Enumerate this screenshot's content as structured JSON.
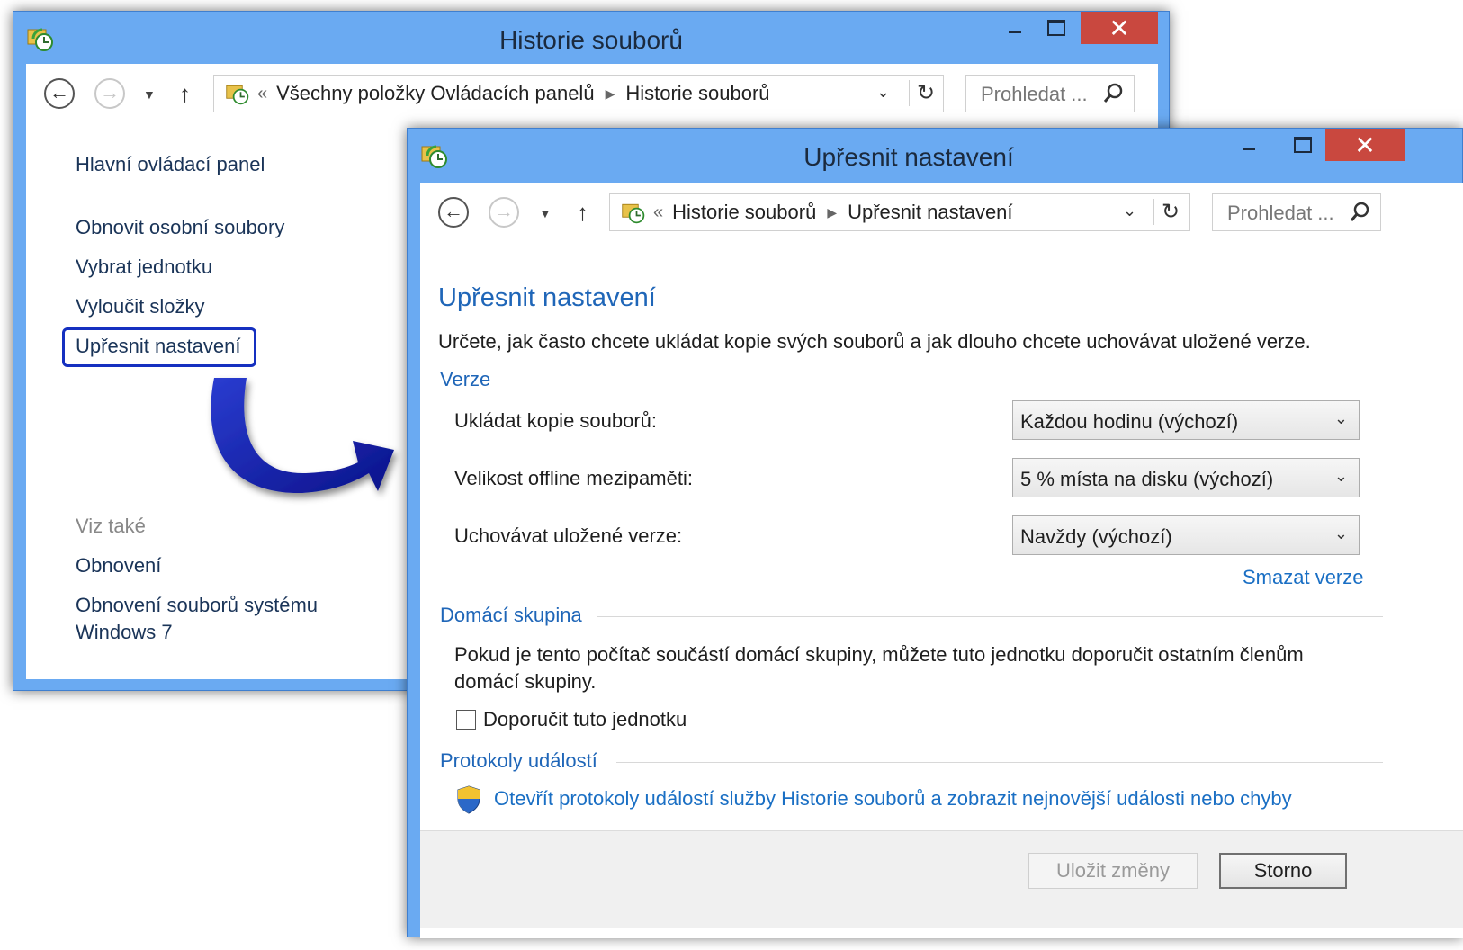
{
  "back_window": {
    "title": "Historie souborů",
    "address": {
      "overflow": "«",
      "crumb1": "Všechny položky Ovládacích panelů",
      "crumb2": "Historie souborů"
    },
    "search_placeholder": "Prohledat ...",
    "home_link": "Hlavní ovládací panel",
    "links": [
      "Obnovit osobní soubory",
      "Vybrat jednotku",
      "Vyloučit složky",
      "Upřesnit nastavení"
    ],
    "see_also": "Viz také",
    "see_also_links": [
      "Obnovení",
      "Obnovení souborů systému",
      "Windows 7"
    ]
  },
  "front_window": {
    "title": "Upřesnit nastavení",
    "address": {
      "overflow": "«",
      "crumb1": "Historie souborů",
      "crumb2": "Upřesnit nastavení"
    },
    "search_placeholder": "Prohledat ...",
    "heading": "Upřesnit nastavení",
    "intro": "Určete, jak často chcete ukládat kopie svých souborů a jak dlouho chcete uchovávat uložené verze.",
    "versions": {
      "label": "Verze",
      "save_copies_label": "Ukládat kopie souborů:",
      "save_copies_value": "Každou hodinu (výchozí)",
      "offline_cache_label": "Velikost offline mezipaměti:",
      "offline_cache_value": "5 % místa na disku (výchozí)",
      "keep_versions_label": "Uchovávat uložené verze:",
      "keep_versions_value": "Navždy (výchozí)",
      "delete_versions_link": "Smazat verze"
    },
    "homegroup": {
      "label": "Domácí skupina",
      "text_line1": "Pokud je tento počítač součástí domácí skupiny, můžete tuto jednotku doporučit ostatním členům",
      "text_line2": "domácí skupiny.",
      "checkbox_label": "Doporučit tuto jednotku",
      "checkbox_checked": false
    },
    "event_logs": {
      "label": "Protokoly událostí",
      "link": "Otevřít protokoly událostí služby Historie souborů a zobrazit nejnovější události nebo chyby"
    },
    "buttons": {
      "save": "Uložit změny",
      "cancel": "Storno"
    }
  },
  "colors": {
    "frame": "#6aaaf2",
    "close": "#c9483f",
    "link": "#1a6fc4",
    "heading": "#1f66b8",
    "highlight": "#1530c0",
    "arrow": "#0a1ea0"
  }
}
